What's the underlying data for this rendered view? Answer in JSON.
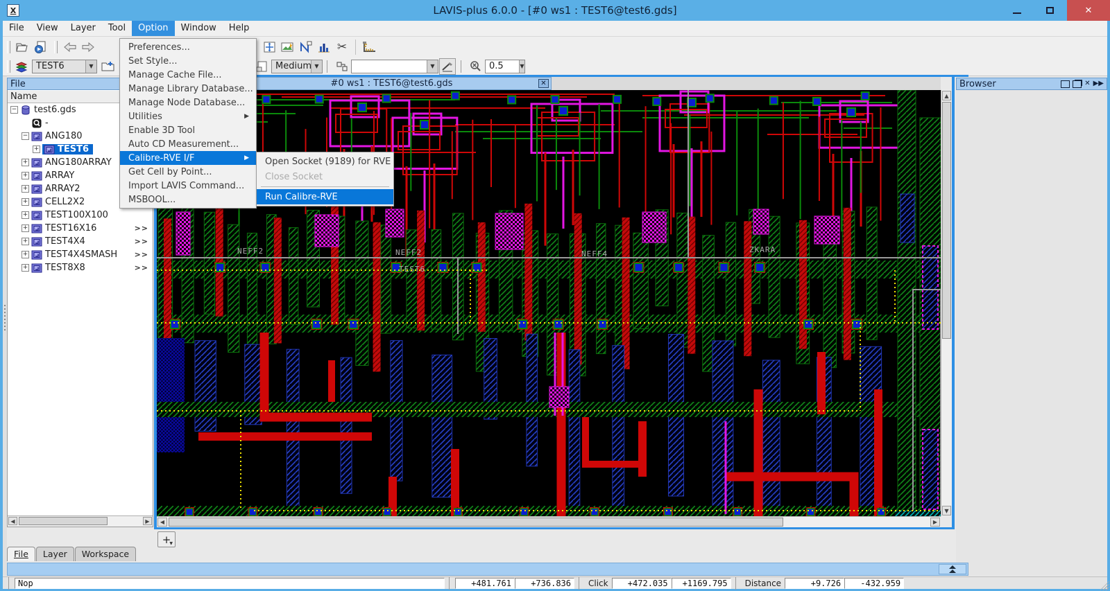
{
  "window": {
    "title": "LAVIS-plus 6.0.0 - [#0 ws1 : TEST6@test6.gds]",
    "icon_letter": "X"
  },
  "menubar": {
    "items": [
      {
        "label": "File"
      },
      {
        "label": "View"
      },
      {
        "label": "Layer"
      },
      {
        "label": "Tool"
      },
      {
        "label": "Option",
        "active": true
      },
      {
        "label": "Window"
      },
      {
        "label": "Help"
      }
    ]
  },
  "option_menu": {
    "items": [
      {
        "label": "Preferences..."
      },
      {
        "label": "Set Style..."
      },
      {
        "label": "Manage Cache File..."
      },
      {
        "label": "Manage Library Database..."
      },
      {
        "label": "Manage Node Database..."
      },
      {
        "label": "Utilities",
        "submenu": true
      },
      {
        "label": "Enable 3D Tool"
      },
      {
        "label": "Auto CD Measurement..."
      },
      {
        "label": "Calibre-RVE I/F",
        "submenu": true,
        "highlighted": true
      },
      {
        "label": "Get Cell by Point..."
      },
      {
        "label": "Import LAVIS Command..."
      },
      {
        "label": "MSBOOL..."
      }
    ]
  },
  "calibre_submenu": {
    "items": [
      {
        "label": "Open Socket (9189) for RVE"
      },
      {
        "label": "Close Socket",
        "disabled": true
      },
      {
        "label": "Run Calibre-RVE",
        "highlighted": true
      }
    ]
  },
  "toolbar": {
    "cell_combo_value": "TEST6",
    "detail_combo_value": "Medium",
    "name_combo_value": "",
    "zoom_combo_value": "0.5"
  },
  "file_panel": {
    "title": "File",
    "column_header": "Name",
    "tree": [
      {
        "label": "test6.gds"
      },
      {
        "label": "-"
      },
      {
        "label": "ANG180"
      },
      {
        "label": "TEST6",
        "selected": true
      },
      {
        "label": "ANG180ARRAY"
      },
      {
        "label": "ARRAY"
      },
      {
        "label": "ARRAY2"
      },
      {
        "label": "CELL2X2"
      },
      {
        "label": "TEST100X100"
      },
      {
        "label": "TEST16X16",
        "mark": ">>"
      },
      {
        "label": "TEST4X4",
        "mark": ">>"
      },
      {
        "label": "TEST4X4SMASH",
        "mark": ">>"
      },
      {
        "label": "TEST8X8",
        "mark": ">>"
      }
    ]
  },
  "bottom_tabs": {
    "items": [
      {
        "label": "File",
        "active": true
      },
      {
        "label": "Layer"
      },
      {
        "label": "Workspace"
      }
    ],
    "add_button": "+"
  },
  "canvas": {
    "title": "#0 ws1 : TEST6@test6.gds",
    "labels": [
      {
        "text": "NEFF2"
      },
      {
        "text": "NEFF2"
      },
      {
        "text": "TEST6"
      },
      {
        "text": "NEFF4"
      },
      {
        "text": "ZKARA"
      }
    ],
    "colors": {
      "wire_red": "#CF0707",
      "hatch_green": "#11871A",
      "hatch_blue": "#2742C8",
      "magenta": "#E316E3",
      "select_yellow": "#F0E400",
      "cyan": "#00B8B8"
    }
  },
  "browser_panel": {
    "title": "Browser"
  },
  "statusbar": {
    "mode": "Nop",
    "cursor_x": "+481.761",
    "cursor_y": "+736.836",
    "click_label": "Click",
    "click_x": "+472.035",
    "click_y": "+1169.795",
    "distance_label": "Distance",
    "distance_x": "+9.726",
    "distance_y": "-432.959"
  }
}
